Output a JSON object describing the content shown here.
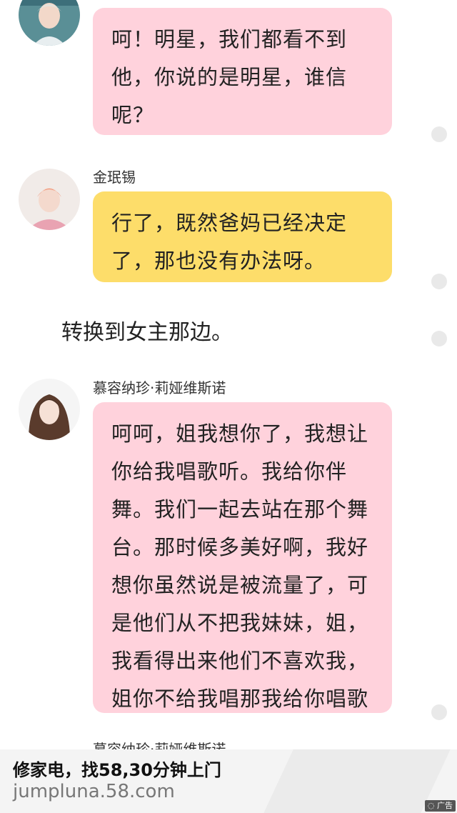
{
  "messages": [
    {
      "sender": "",
      "avatar": "avatar-young-man-icon",
      "bubble_color": "#ffd2dc",
      "lines": [
        "呵！明星，我们都看不到",
        "他，你说的是明星，谁信",
        "呢？"
      ]
    },
    {
      "sender": "金珉锡",
      "avatar": "avatar-pink-shirt-icon",
      "bubble_color": "#fddd6a",
      "lines": [
        "行了，既然爸妈已经决定",
        "了，那也没有办法呀。"
      ]
    },
    {
      "sender": "慕容纳珍·莉娅维斯诺",
      "avatar": "avatar-girl-icon",
      "bubble_color": "#ffd2dc",
      "lines": [
        "呵呵，姐我想你了，我想让",
        "你给我唱歌听。我给你伴",
        "舞。我们一起去站在那个舞",
        "台。那时候多美好啊，我好",
        "想你虽然说是被流量了，可",
        "是他们从不把我妹妹，姐，",
        "我看得出来他们不喜欢我，",
        "姐你不给我唱那我给你唱歌"
      ]
    }
  ],
  "narration": "转换到女主那边。",
  "next_sender_peek": "慕容纳珍·莉娅维斯诺",
  "ad": {
    "title": "修家电，找58,30分钟上门",
    "url": "jumpluna.58.com",
    "badge": "广告"
  },
  "colors": {
    "pink_bubble": "#ffd2dc",
    "yellow_bubble": "#fddd6a",
    "menu_dot": "#e9e9e9",
    "ad_background": "#f4f4f4"
  }
}
